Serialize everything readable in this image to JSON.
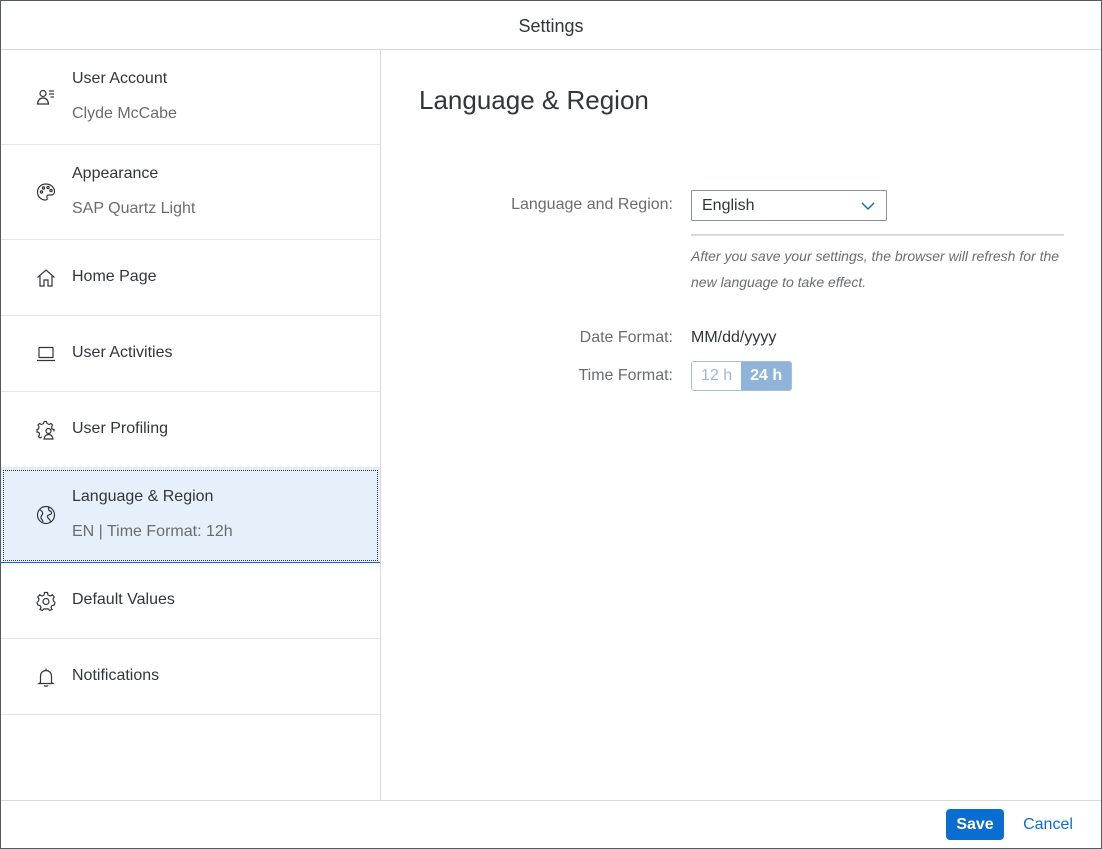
{
  "dialog": {
    "title": "Settings"
  },
  "sidebar": {
    "items": [
      {
        "title": "User Account",
        "subtitle": "Clyde McCabe",
        "icon": "user-account-icon"
      },
      {
        "title": "Appearance",
        "subtitle": "SAP Quartz Light",
        "icon": "palette-icon"
      },
      {
        "title": "Home Page",
        "icon": "home-icon"
      },
      {
        "title": "User Activities",
        "icon": "laptop-icon"
      },
      {
        "title": "User Profiling",
        "icon": "user-settings-icon"
      },
      {
        "title": "Language & Region",
        "subtitle": "EN | Time Format: 12h",
        "icon": "globe-icon",
        "selected": true
      },
      {
        "title": "Default Values",
        "icon": "gear-icon"
      },
      {
        "title": "Notifications",
        "icon": "bell-icon"
      }
    ]
  },
  "main": {
    "title": "Language & Region",
    "language_label": "Language and Region:",
    "language_value": "English",
    "hint": "After you save your settings, the browser will refresh for the new language to take effect.",
    "date_label": "Date Format:",
    "date_value": "MM/dd/yyyy",
    "time_label": "Time Format:",
    "time_options": [
      "12 h",
      "24 h"
    ],
    "time_selected": "24 h"
  },
  "footer": {
    "save_label": "Save",
    "cancel_label": "Cancel"
  },
  "colors": {
    "accent": "#0a6ed1",
    "selected_bg": "#e5f0fa",
    "toggle_on": "#90b4d9"
  }
}
